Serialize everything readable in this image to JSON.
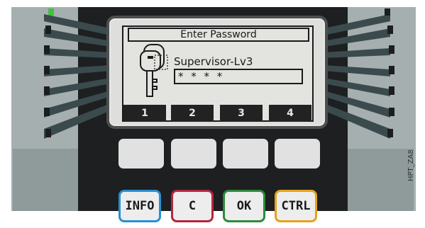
{
  "display": {
    "title": "Enter Password",
    "user_level": "Supervisor-Lv3",
    "password_mask": "* * * *",
    "softkeys": [
      "1",
      "2",
      "3",
      "4"
    ]
  },
  "keypad": {
    "info_label": "INFO",
    "c_label": "C",
    "ok_label": "OK",
    "ctrl_label": "CTRL"
  },
  "figure_id": "HPT_ZA8",
  "colors": {
    "info": "#2a8fd0",
    "c": "#b5263f",
    "ok": "#2c8a3a",
    "ctrl": "#e6a21a",
    "led": "#43c043"
  },
  "icons": {
    "display": "key-icon"
  }
}
